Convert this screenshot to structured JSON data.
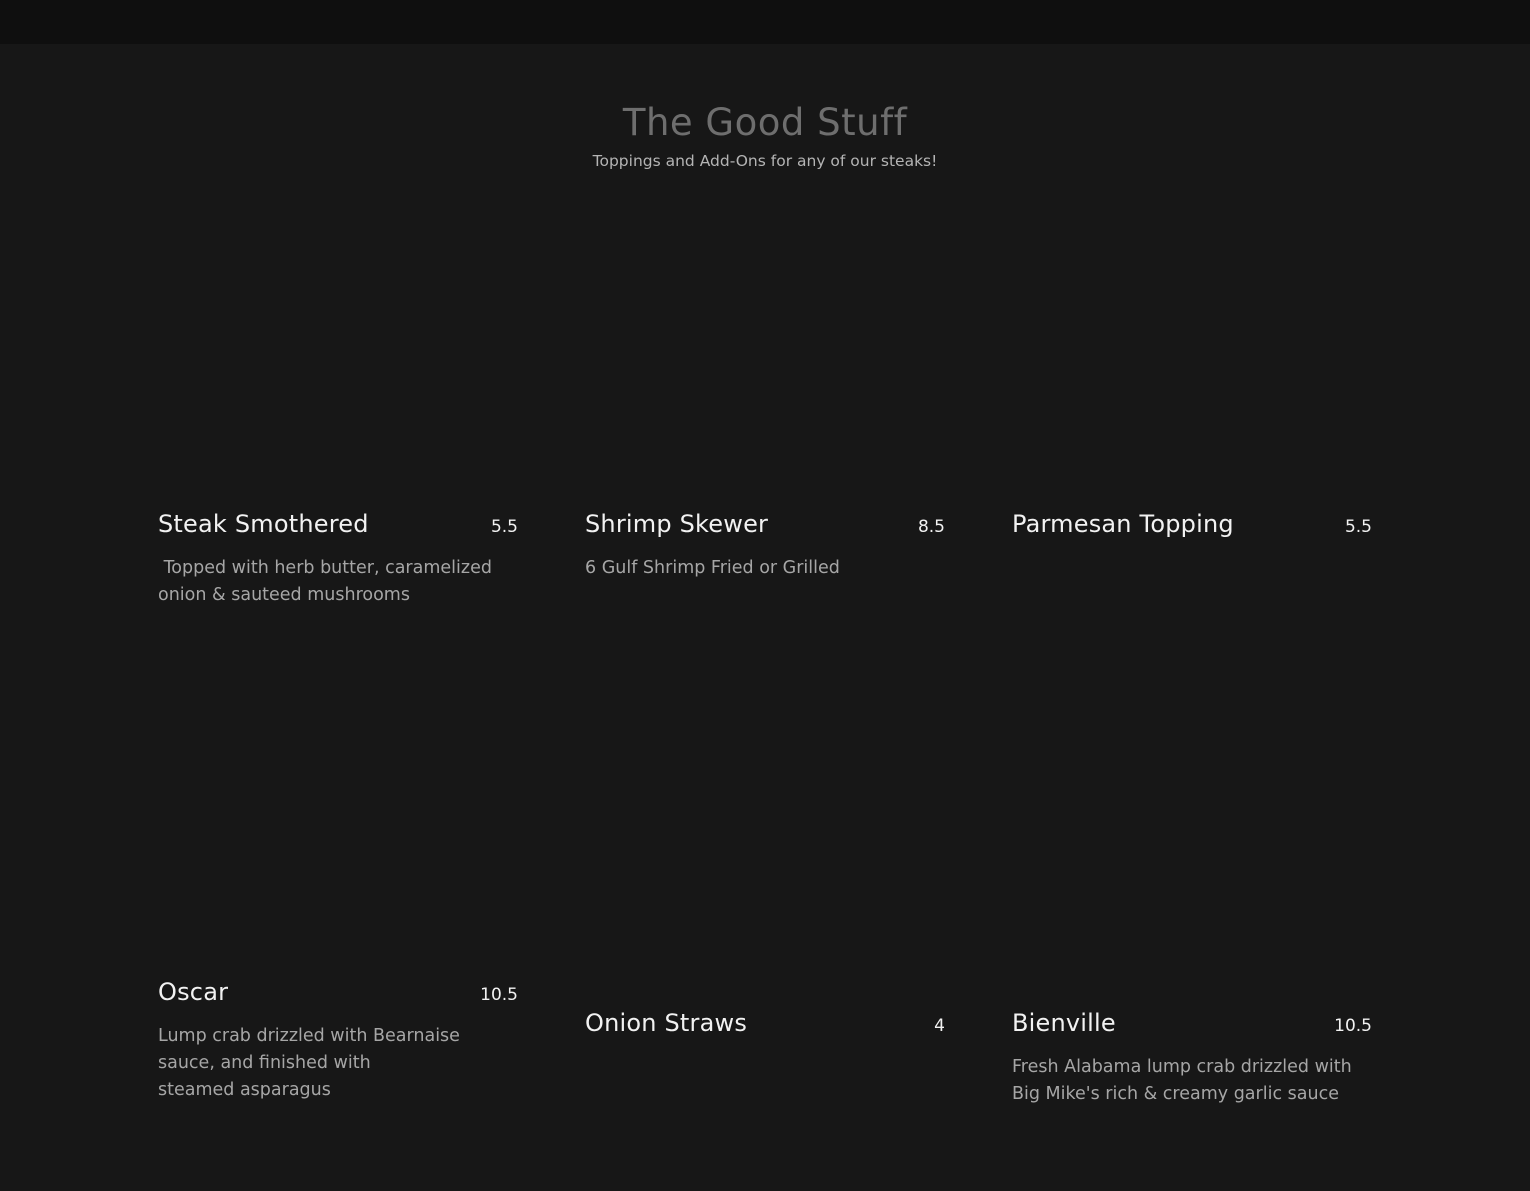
{
  "heading": {
    "title": "The Good Stuff",
    "subtitle": "Toppings and Add-Ons for any of our steaks!"
  },
  "items": [
    {
      "name": "Steak Smothered",
      "price": "5.5",
      "description": " Topped with herb butter, caramelized onion & sauteed mushrooms"
    },
    {
      "name": "Shrimp Skewer",
      "price": "8.5",
      "description": "6 Gulf Shrimp Fried or Grilled"
    },
    {
      "name": "Parmesan Topping",
      "price": "5.5",
      "description": ""
    },
    {
      "name": "Oscar",
      "price": "10.5",
      "description": "Lump crab drizzled with Bearnaise sauce, and finished with\nsteamed asparagus"
    },
    {
      "name": "Onion Straws",
      "price": "4",
      "description": ""
    },
    {
      "name": "Bienville",
      "price": "10.5",
      "description": "Fresh Alabama lump crab drizzled with Big Mike's rich & creamy garlic sauce"
    }
  ],
  "colors": {
    "background": "#171717",
    "topbar": "#0f0f0f",
    "title": "#6e6e6e",
    "text": "#f2f2f2",
    "muted": "#a6a6a6"
  }
}
